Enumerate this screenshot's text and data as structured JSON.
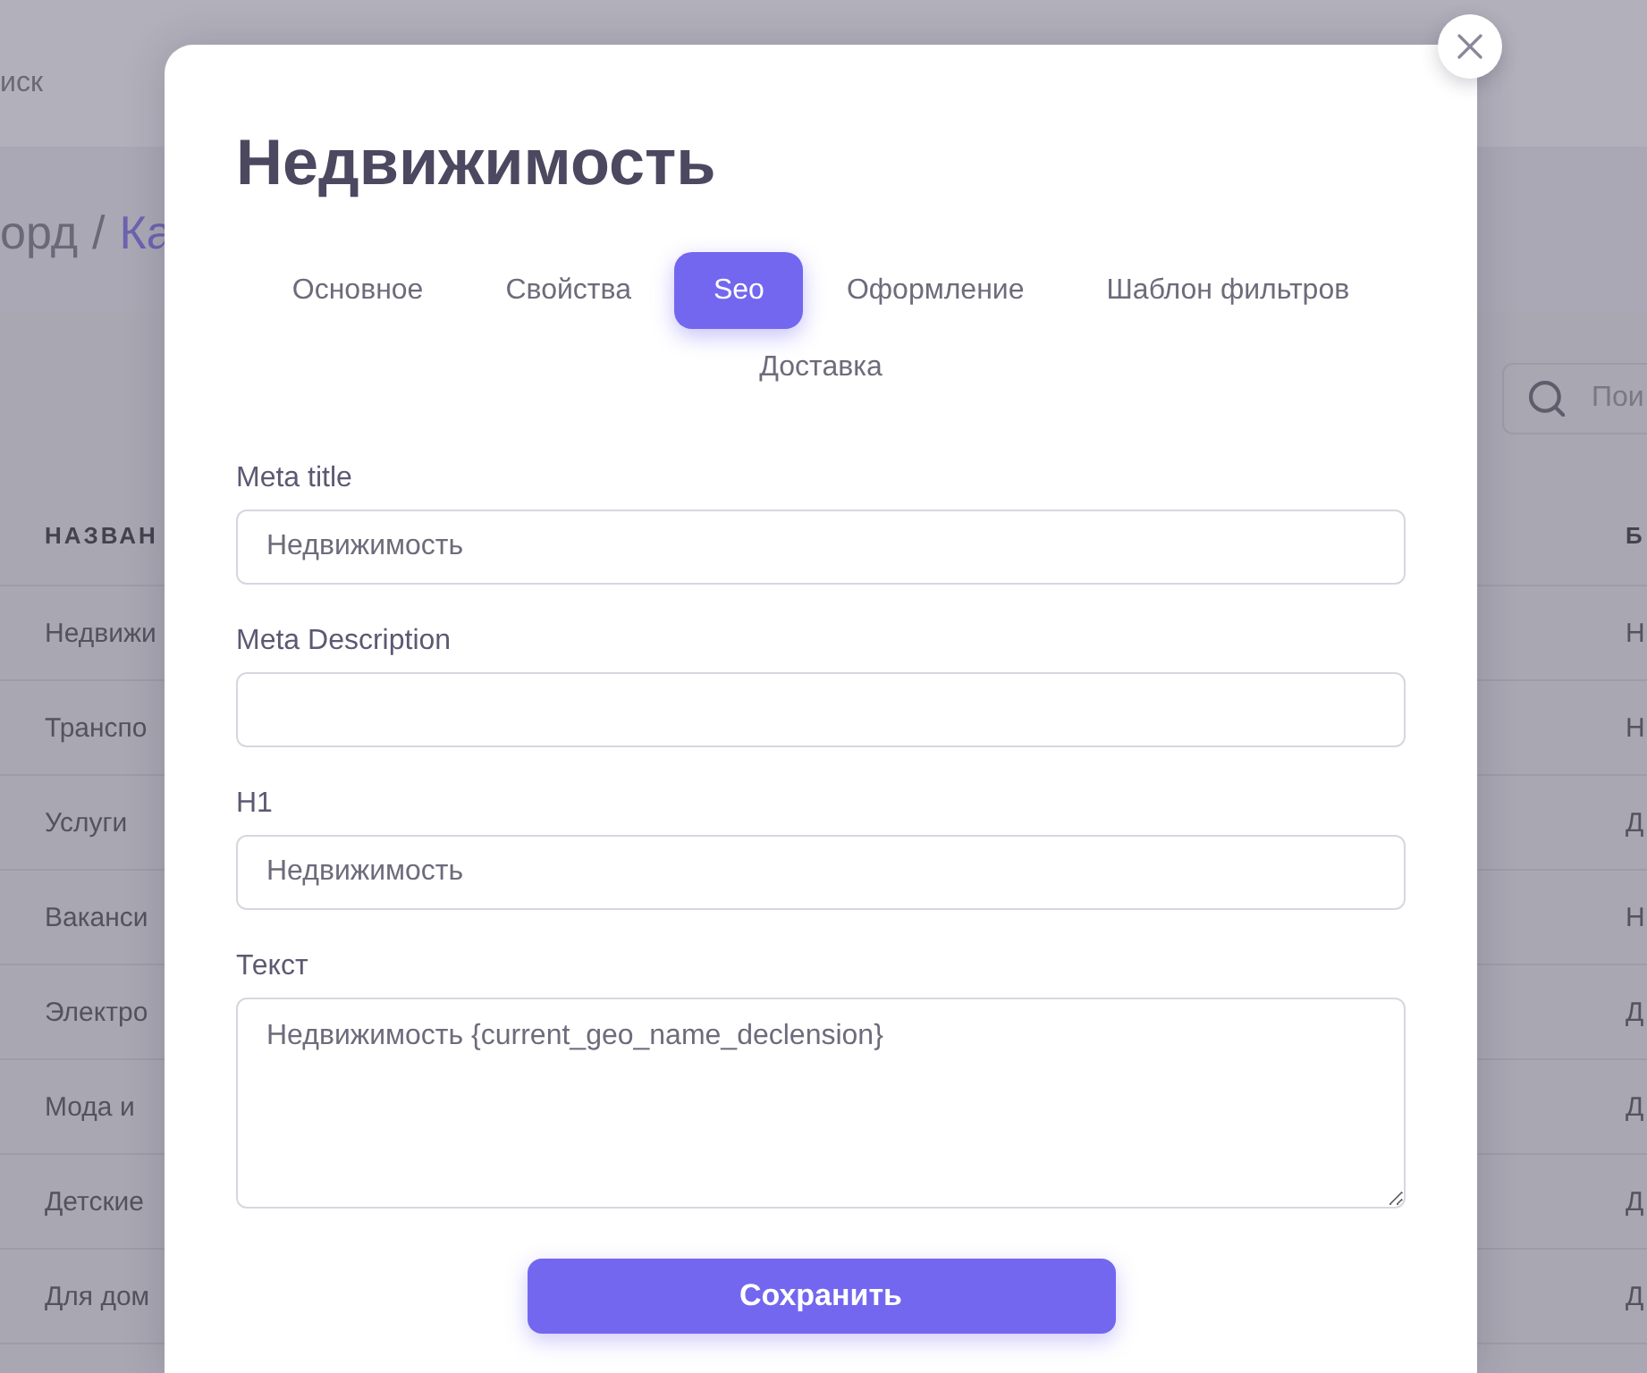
{
  "background_page": {
    "top_bar": {
      "search_text": "иск"
    },
    "breadcrumb": [
      {
        "text": "орд",
        "kind": "plain"
      },
      {
        "text": "/",
        "kind": "separator"
      },
      {
        "text": "Ка",
        "kind": "link"
      }
    ],
    "search": {
      "placeholder": "Пои"
    },
    "table": {
      "columns": [
        "НАЗВАН",
        "Б"
      ],
      "rows": [
        [
          "Недвижи",
          "Н"
        ],
        [
          "Транспо",
          "Н"
        ],
        [
          "Услуги",
          "Д"
        ],
        [
          "Ваканси",
          "Н"
        ],
        [
          "Электро",
          "Д"
        ],
        [
          "Мода и",
          "Д"
        ],
        [
          "Детские",
          "Д"
        ],
        [
          "Для дом",
          "Д"
        ]
      ]
    }
  },
  "modal": {
    "title": "Недвижимость",
    "tabs": [
      {
        "label": "Основное",
        "selected": false
      },
      {
        "label": "Свойства",
        "selected": false
      },
      {
        "label": "Seo",
        "selected": true
      },
      {
        "label": "Оформление",
        "selected": false
      },
      {
        "label": "Шаблон фильтров",
        "selected": false
      },
      {
        "label": "Доставка",
        "selected": false
      }
    ],
    "fields": [
      {
        "label": "Meta title",
        "kind": "input",
        "value": "Недвижимость"
      },
      {
        "label": "Meta Description",
        "kind": "input"
      },
      {
        "label": "H1",
        "kind": "input",
        "value": "Недвижимость"
      },
      {
        "label": "Текст",
        "kind": "textarea",
        "value": "Недвижимость {current_geo_name_declension}"
      }
    ],
    "submit_button": "Сохранить"
  }
}
